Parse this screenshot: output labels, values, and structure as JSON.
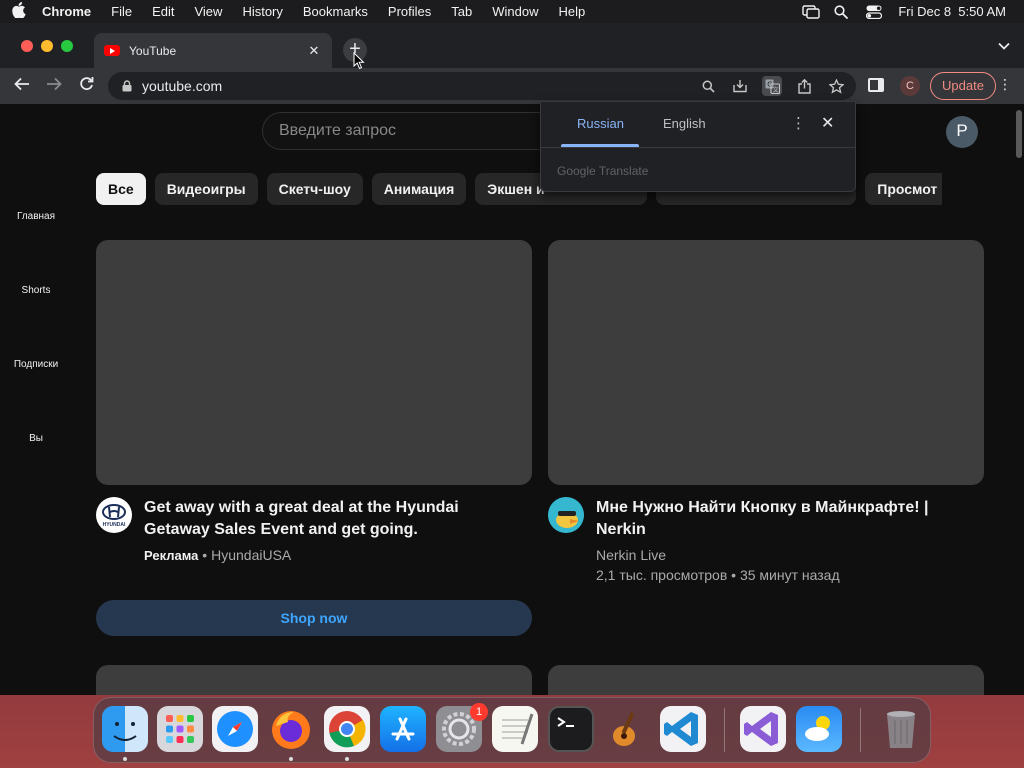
{
  "menubar": {
    "app_name": "Chrome",
    "items": [
      "File",
      "Edit",
      "View",
      "History",
      "Bookmarks",
      "Profiles",
      "Tab",
      "Window",
      "Help"
    ],
    "datetime": "Fri Dec 8  5:50 AM"
  },
  "browser": {
    "tab_title": "YouTube",
    "url": "youtube.com",
    "profile_initial": "C",
    "update_label": "Update"
  },
  "youtube": {
    "search_placeholder": "Введите запрос",
    "avatar_initial": "P",
    "sidebar": [
      "Главная",
      "Shorts",
      "Подписки",
      "Вы"
    ],
    "chips": [
      "Все",
      "Видеоигры",
      "Скетч-шоу",
      "Анимация",
      "Экшен и ",
      "",
      "",
      "Просмот"
    ],
    "ad": {
      "title": "Get away with a great deal at the Hyundai Getaway Sales Event and get going.",
      "ad_label": "Реклама",
      "channel": "HyundaiUSA",
      "cta": "Shop now",
      "logo_text": "HYUNDAI"
    },
    "video": {
      "title": "Мне Нужно Найти Кнопку в Майнкрафте! | Nerkin",
      "channel": "Nerkin Live",
      "stats": "2,1 тыс. просмотров • 35 минут назад"
    }
  },
  "translate_popup": {
    "tabs": [
      "Russian",
      "English"
    ],
    "brand": "Google Translate"
  },
  "dock": {
    "settings_badge": "1"
  },
  "colors": {
    "yt_background": "#0f0f0f",
    "accent_blue": "#8ab4f8",
    "update_red": "#f28b82",
    "link_blue": "#3ea6ff"
  }
}
